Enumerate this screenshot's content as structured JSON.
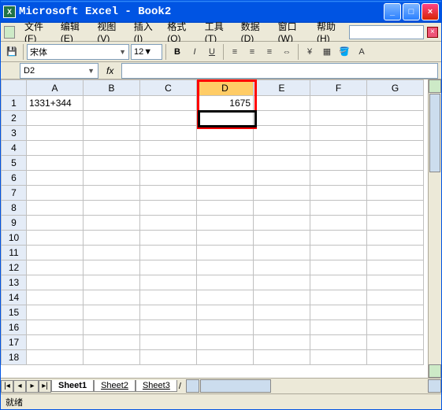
{
  "window": {
    "title": "Microsoft Excel - Book2"
  },
  "menu": {
    "items": [
      "文件(F)",
      "编辑(E)",
      "视图(V)",
      "插入(I)",
      "格式(O)",
      "工具(T)",
      "数据(D)",
      "窗口(W)",
      "帮助(H)"
    ]
  },
  "toolbar": {
    "font_name": "宋体",
    "font_size": "12",
    "bold": "B",
    "italic": "I",
    "underline": "U"
  },
  "namebox": {
    "value": "D2",
    "fx": "fx",
    "formula": ""
  },
  "columns": [
    "A",
    "B",
    "C",
    "D",
    "E",
    "F",
    "G"
  ],
  "rows": [
    "1",
    "2",
    "3",
    "4",
    "5",
    "6",
    "7",
    "8",
    "9",
    "10",
    "11",
    "12",
    "13",
    "14",
    "15",
    "16",
    "17",
    "18"
  ],
  "cells": {
    "A1": "1331+344",
    "D1": "1675"
  },
  "selected_col": "D",
  "tabs": {
    "items": [
      "Sheet1",
      "Sheet2",
      "Sheet3"
    ],
    "active": "Sheet1"
  },
  "status": {
    "text": "就绪"
  }
}
